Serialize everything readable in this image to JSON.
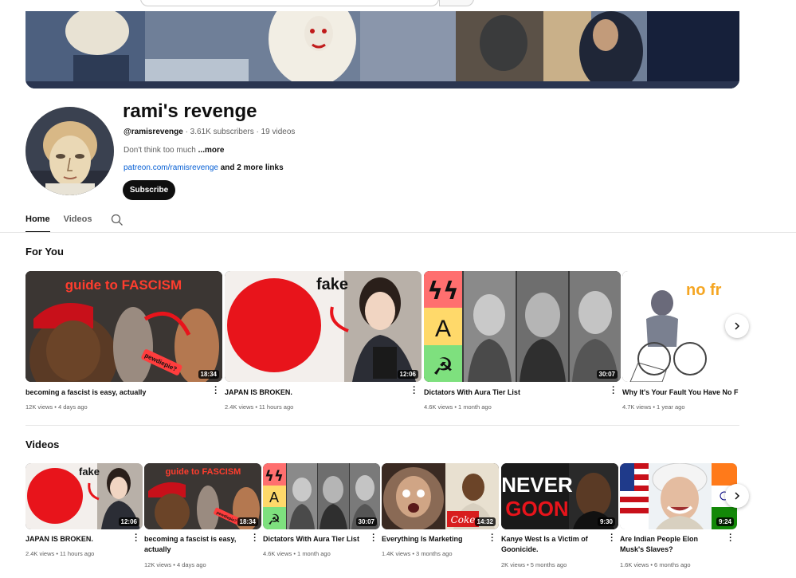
{
  "channel": {
    "name": "rami's revenge",
    "handle": "@ramisrevenge",
    "stats": " · 3.61K subscribers · 19 videos",
    "description": "Don't think too much",
    "more_label": " ...more",
    "link": "patreon.com/ramisrevenge",
    "more_links": " and 2 more links",
    "subscribe_label": "Subscribe"
  },
  "tabs": [
    {
      "label": "Home",
      "active": true
    },
    {
      "label": "Videos",
      "active": false
    }
  ],
  "icons": {
    "tab_search": "search-icon",
    "next": "chevron-right-icon",
    "menu": "more-vert-icon"
  },
  "sections": {
    "for_you": {
      "title": "For You",
      "videos": [
        {
          "title": "becoming a fascist is easy, actually",
          "meta": "12K views • 4 days ago",
          "duration": "18:34",
          "thumb_text": "guide to FASCISM",
          "thumb_sub": "pewdiepie?"
        },
        {
          "title": "JAPAN IS BROKEN.",
          "meta": "2.4K views • 11 hours ago",
          "duration": "12:06",
          "thumb_text": "fake"
        },
        {
          "title": "Dictators With Aura Tier List",
          "meta": "4.6K views • 1 month ago",
          "duration": "30:07",
          "tiers": [
            "SS",
            "A",
            "☭"
          ]
        },
        {
          "title": "Why It's Your Fault You Have No F",
          "meta": "4.7K views • 1 year ago",
          "duration": "",
          "thumb_text": "no fr"
        }
      ]
    },
    "videos": {
      "title": "Videos",
      "videos": [
        {
          "title": "JAPAN IS BROKEN.",
          "meta": "2.4K views • 11 hours ago",
          "duration": "12:06",
          "thumb_text": "fake"
        },
        {
          "title": "becoming a fascist is easy, actually",
          "meta": "12K views • 4 days ago",
          "duration": "18:34",
          "thumb_text": "guide to FASCISM",
          "thumb_sub": "pewdiepie?"
        },
        {
          "title": "Dictators With Aura Tier List",
          "meta": "4.6K views • 1 month ago",
          "duration": "30:07",
          "tiers": [
            "SS",
            "A",
            "☭"
          ]
        },
        {
          "title": "Everything Is Marketing",
          "meta": "1.4K views • 3 months ago",
          "duration": "14:32",
          "thumb_text": "Coke"
        },
        {
          "title": "Kanye West Is a Victim of Goonicide.",
          "meta": "2K views • 5 months ago",
          "duration": "9:30",
          "thumb_text": "NEVER",
          "thumb_sub": "GOON"
        },
        {
          "title": "Are Indian People Elon Musk's Slaves?",
          "meta": "1.6K views • 6 months ago",
          "duration": "9:24"
        }
      ]
    }
  },
  "colors": {
    "accent_red": "#e8141b",
    "link_blue": "#065fd4",
    "thumb_orange": "#ff6a13"
  }
}
